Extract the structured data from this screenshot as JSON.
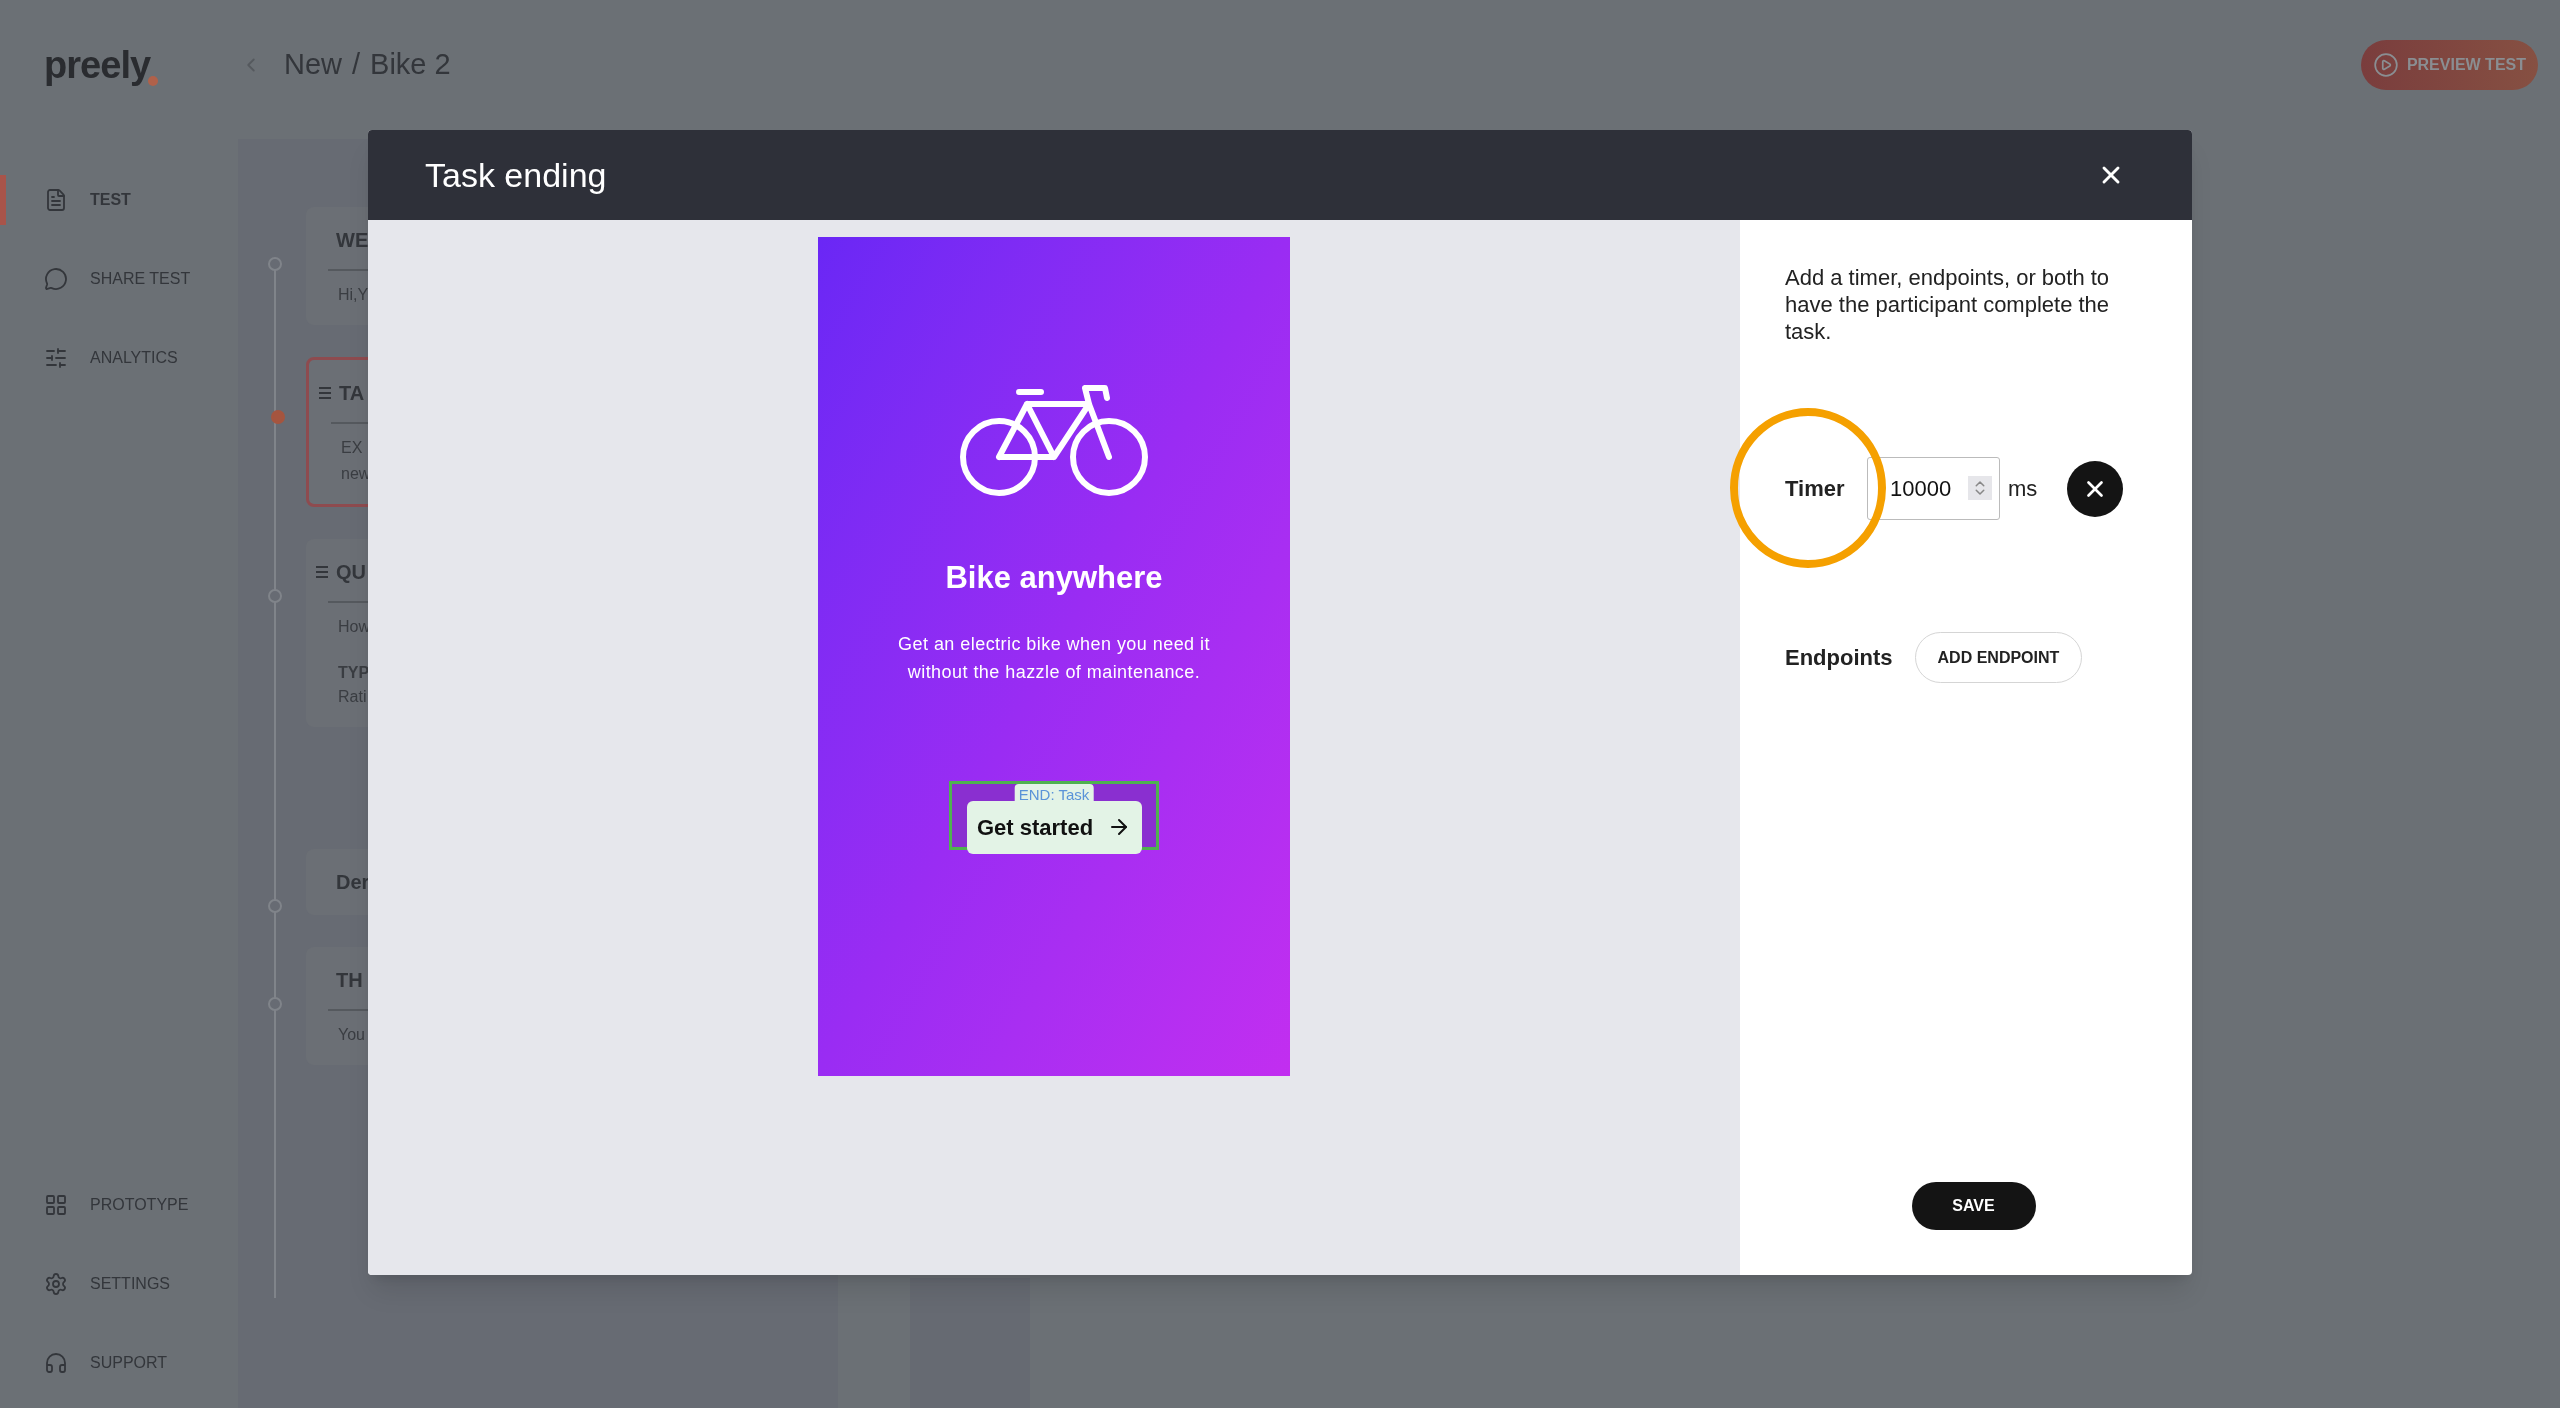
{
  "header": {
    "logo": "preely",
    "breadcrumb": [
      {
        "label": "New"
      },
      {
        "label": "Bike 2"
      }
    ],
    "separator": "/",
    "preview_button": "PREVIEW TEST"
  },
  "sidebar": {
    "items": [
      {
        "label": "TEST",
        "kind": "document",
        "selected": true
      },
      {
        "label": "SHARE TEST",
        "kind": "chat",
        "selected": false
      },
      {
        "label": "ANALYTICS",
        "kind": "analytics",
        "selected": false
      }
    ],
    "bottom_items": [
      {
        "label": "PROTOTYPE",
        "kind": "grid"
      },
      {
        "label": "SETTINGS",
        "kind": "gear"
      },
      {
        "label": "SUPPORT",
        "kind": "headset"
      }
    ]
  },
  "cards": [
    {
      "title": "WE",
      "lines": [
        "Hi,Y"
      ],
      "selected": false,
      "handle": false,
      "divider": true
    },
    {
      "title": "TA",
      "lines": [
        "EX",
        "new"
      ],
      "selected": true,
      "handle": true,
      "divider": true
    },
    {
      "title": "QU",
      "lines": [
        "How",
        "TYP",
        "Rati"
      ],
      "selected": false,
      "handle": true,
      "divider": true
    },
    {
      "title": "Der",
      "selected": false,
      "handle": false,
      "divider": false
    },
    {
      "title": "TH",
      "lines": [
        "You"
      ],
      "selected": false,
      "handle": false,
      "divider": true
    }
  ],
  "modal": {
    "title": "Task ending",
    "prototype": {
      "heading": "Bike anywhere",
      "text": "Get an electric bike when you need it without the hazzle of maintenance.",
      "button": "Get started",
      "endpoint_label": "END: Task"
    },
    "panel": {
      "intro": "Add a timer, endpoints, or both to have the participant complete the task.",
      "timer": {
        "label": "Timer",
        "value": "10000",
        "unit": "ms"
      },
      "endpoints": {
        "label": "Endpoints",
        "button": "ADD ENDPOINT"
      },
      "save": "SAVE"
    }
  }
}
